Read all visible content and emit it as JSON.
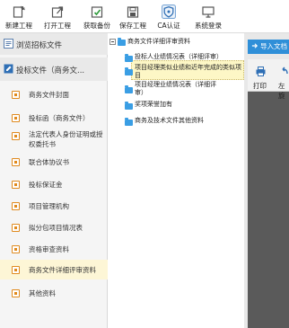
{
  "toolbar": {
    "buttons": [
      {
        "label": "新建工程",
        "icon": "new-project-icon"
      },
      {
        "label": "打开工程",
        "icon": "open-project-icon"
      },
      {
        "label": "获取备份",
        "icon": "get-backup-icon"
      },
      {
        "label": "保存工程",
        "icon": "save-project-icon"
      },
      {
        "label": "CA认证",
        "icon": "ca-shield-icon"
      },
      {
        "label": "系统登录",
        "icon": "login-monitor-icon"
      }
    ]
  },
  "sidebar": {
    "browse_label": "浏览招标文件",
    "section_label": "投标文件（商务文...",
    "items": [
      {
        "label": "商务文件封面"
      },
      {
        "label": "投标函（商务文件）"
      },
      {
        "label": "法定代表人身份证明或授权委托书"
      },
      {
        "label": "联合体协议书"
      },
      {
        "label": "投标保证金"
      },
      {
        "label": "项目管理机构"
      },
      {
        "label": "拟分包项目情况表"
      },
      {
        "label": "资格审查资料"
      },
      {
        "label": "商务文件详细评审资料"
      },
      {
        "label": "其他资料"
      }
    ],
    "active_index": 8
  },
  "tree": {
    "root": "商务文件详细评审资料",
    "children": [
      {
        "lines": [
          "投标人业绩情况表（详细评审）"
        ]
      },
      {
        "lines": [
          "项目经理类似业绩和近年完成的类似项",
          "目"
        ]
      },
      {
        "lines": [
          "项目经理业绩情况表（详细评",
          "审）"
        ]
      },
      {
        "lines": [
          "奖项荣誉加有"
        ]
      },
      {
        "lines": [
          "商务及技术文件其他资料"
        ]
      }
    ],
    "selected_index": 1
  },
  "right_panel": {
    "import_label": "导入文档",
    "print_label": "打印",
    "left_label": "左旋"
  },
  "colors": {
    "accent": "#2f8fd8",
    "folder": "#3a9ee4",
    "sidebar_icon": "#e08a1e",
    "selection": "#fdf7c6"
  }
}
